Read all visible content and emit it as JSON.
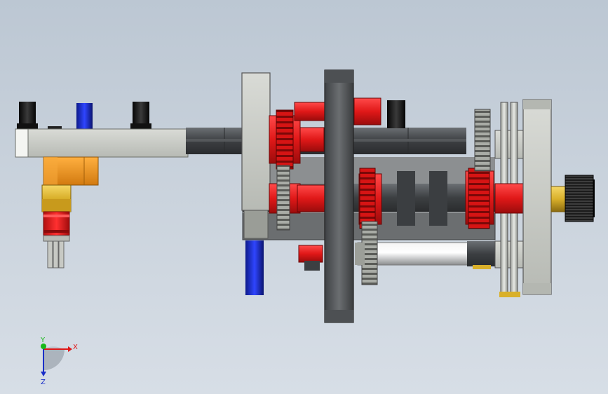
{
  "viewport": {
    "triad": {
      "x_label": "X",
      "y_label": "Y",
      "z_label": "Z"
    },
    "colors": {
      "background_top": "#bcc7d3",
      "background_bottom": "#d7dee6",
      "frame_gray": "#c8cbc6",
      "shaft_dark": "#4a4d50",
      "gear_red": "#e01818",
      "pin_blue": "#1a2fc8",
      "bracket_orange": "#f0961a",
      "brass": "#d9b02a",
      "knob_black": "#1a1a1a"
    },
    "parts": [
      "base-arm",
      "black-posts",
      "blue-pin",
      "orange-bracket",
      "yellow-collar",
      "red-coupling",
      "gray-plate",
      "main-shaft",
      "gear-stack",
      "central-disc",
      "right-frame",
      "end-plate",
      "knurled-knob",
      "bottom-shaft",
      "blue-rod"
    ]
  }
}
